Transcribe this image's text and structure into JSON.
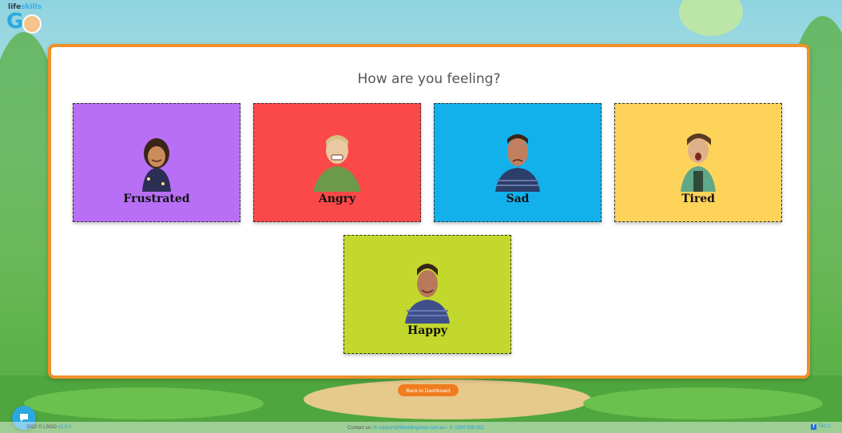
{
  "logo": {
    "top_text_a": "life",
    "top_text_b": "skills",
    "letters": "G"
  },
  "page": {
    "title": "How are you feeling?"
  },
  "feelings": [
    {
      "label": "Frustrated",
      "color": "#b86ff6"
    },
    {
      "label": "Angry",
      "color": "#fb4848"
    },
    {
      "label": "Sad",
      "color": "#12b1ec"
    },
    {
      "label": "Tired",
      "color": "#fed35a"
    },
    {
      "label": "Happy",
      "color": "#c3d82d"
    }
  ],
  "actions": {
    "back_label": "Back to Dashboard"
  },
  "footer": {
    "copyright": "2022 © LSGO",
    "version": "v3.3.0",
    "contact_label": "Contact us:",
    "email": "support@lifeskillsgroup.com.au",
    "separator": "-",
    "phone": "1300 908 051",
    "tcs": "T&C's"
  }
}
